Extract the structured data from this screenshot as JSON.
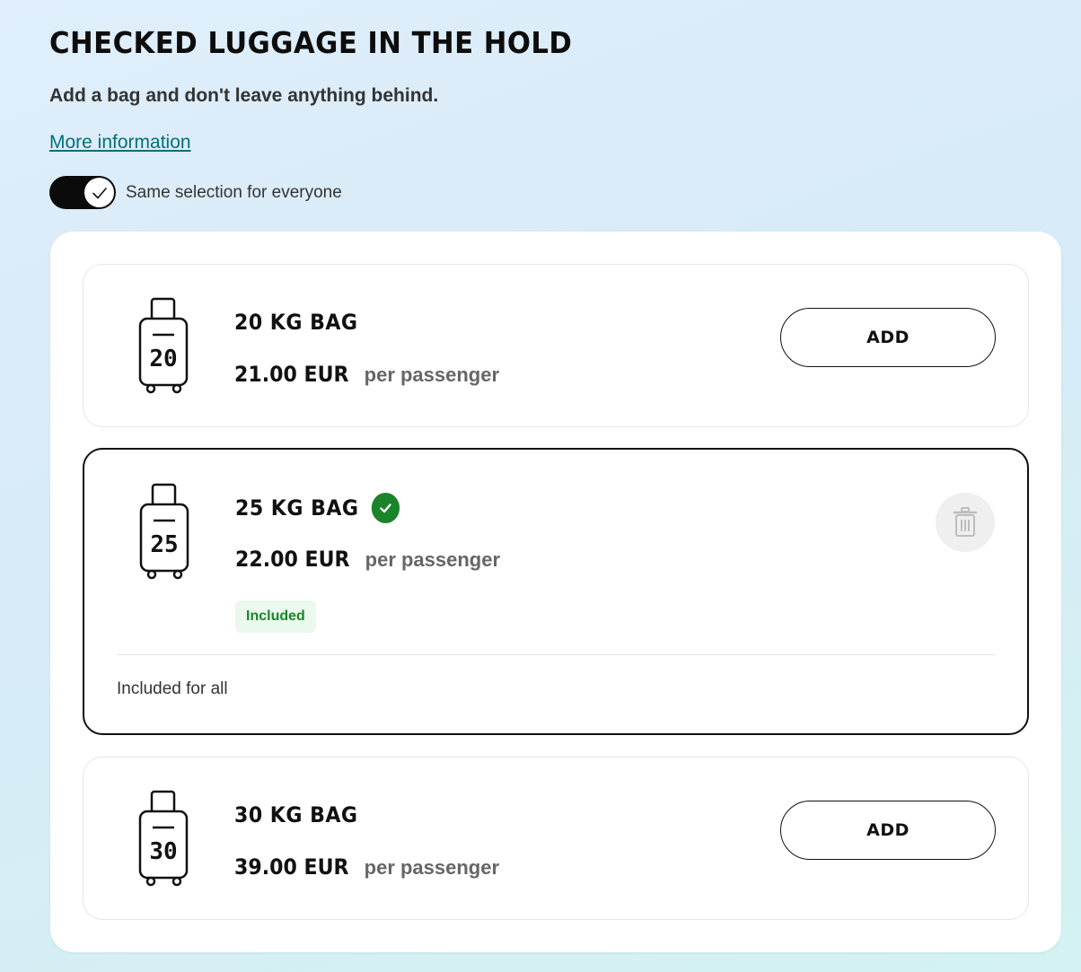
{
  "header": {
    "title": "CHECKED LUGGAGE IN THE HOLD",
    "subtitle": "Add a bag and don't leave anything behind.",
    "more_link": "More information"
  },
  "toggle": {
    "label": "Same selection for everyone",
    "on": true
  },
  "options": [
    {
      "bag_number": "20",
      "name": "20 KG BAG",
      "price": "21.00 EUR",
      "per": "per passenger",
      "button": "ADD"
    },
    {
      "bag_number": "25",
      "name": "25 KG BAG",
      "price": "22.00 EUR",
      "per": "per passenger",
      "badge": "Included",
      "footer": "Included for all",
      "selected": true
    },
    {
      "bag_number": "30",
      "name": "30 KG BAG",
      "price": "39.00 EUR",
      "per": "per passenger",
      "button": "ADD"
    }
  ],
  "colors": {
    "link": "#00707a",
    "success": "#19842a",
    "toggle_bg": "#0b0b0b"
  }
}
